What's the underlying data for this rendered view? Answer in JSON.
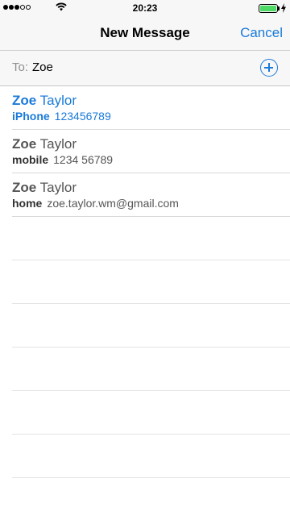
{
  "status_bar": {
    "time": "20:23",
    "signal_full": 3,
    "signal_total": 5,
    "battery_level": 1.0,
    "battery_color": "#4cd964"
  },
  "nav": {
    "title": "New Message",
    "cancel_label": "Cancel"
  },
  "to_field": {
    "label": "To:",
    "value": "Zoe",
    "add_icon": "plus-circle-icon"
  },
  "suggestions": [
    {
      "name_match": "Zoe",
      "name_rest": " Taylor",
      "type": "iPhone",
      "value": "123456789",
      "active": true
    },
    {
      "name_match": "Zoe",
      "name_rest": " Taylor",
      "type": "mobile",
      "value": "1234 56789",
      "active": false
    },
    {
      "name_match": "Zoe",
      "name_rest": " Taylor",
      "type": "home",
      "value": "zoe.taylor.wm@gmail.com",
      "active": false
    }
  ],
  "colors": {
    "accent": "#1a7ad9",
    "bar_background": "#f7f7f7",
    "separator": "#d9d9dc"
  }
}
